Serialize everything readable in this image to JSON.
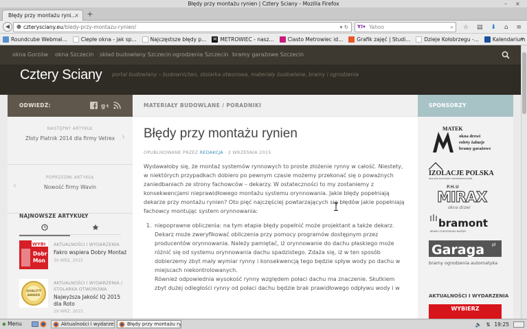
{
  "window": {
    "title": "Błędy przy montażu rynien | Cztery Sciany - Mozilla Firefox",
    "controls": [
      "–",
      "×"
    ]
  },
  "tabs": [
    {
      "label": "Błędy przy montażu ryni...",
      "close": "×"
    }
  ],
  "new_tab": "+",
  "address": {
    "host": "czterysciany.eu",
    "path": "/bledy-przy-montazu-rynien/",
    "icons": "▾ ↻"
  },
  "search": {
    "engine": "Y!▾",
    "placeholder": "Yahoo",
    "go": "🔍"
  },
  "bookmarks": [
    {
      "label": "Roundcube Webmai...",
      "icon_color": "#5a8fd0",
      "icon": ""
    },
    {
      "label": "Ciepłe okna - jak sp...",
      "icon_color": "#cfcfcf",
      "icon": ""
    },
    {
      "label": "Najczęstsze błędy p...",
      "icon_color": "#cfcfcf",
      "icon": ""
    },
    {
      "label": "METROWIEC - nasz...",
      "icon_color": "#111111",
      "icon": "M"
    },
    {
      "label": "Ciasto Metrowiec id...",
      "icon_color": "#c81c7b",
      "icon": ""
    },
    {
      "label": "Grafik zajęć | Studi...",
      "icon_color": "#e6582a",
      "icon": ""
    },
    {
      "label": "Dzieje Kołobrzegu -...",
      "icon_color": "#cfcfcf",
      "icon": ""
    },
    {
      "label": "Kalendarium Histor...",
      "icon_color": "#1b4fa0",
      "icon": ""
    }
  ],
  "bookmarks_more": "»",
  "site": {
    "nav": [
      "okna Gorzów",
      "okna Szczecin",
      "skład budowlany Szczecin",
      "ogrodzenia Szczecin",
      "bramy garażowe Szczecin"
    ],
    "title": "Cztery Sciany",
    "tagline": "portal budowlany – budownictwo, stolarka otworowa, materiały budowlane, bramy i ogrodzenia"
  },
  "left": {
    "follow_label": "ODWIEDŹ:",
    "next": {
      "kicker": "NASTĘPNY ARTYKUŁ",
      "title": "Złoty Platnik 2014 dla firmy Vetrex",
      "arrow": "›"
    },
    "prev": {
      "kicker": "POPRZEDNI ARTYKUŁ",
      "title": "Nowość firmy Wavin",
      "arrow": "‹"
    },
    "newest_title": "NAJNOWSZE ARTYKUŁY",
    "posts": [
      {
        "category": "AKTUALNOŚCI I WYDARZENIA",
        "title": "Fakro wspiera Dobry Montaż",
        "date": "30 WRZ, 2015",
        "thumb_text": "WYBIE\nDobr\nMon"
      },
      {
        "category": "AKTUALNOŚCI I WYDARZENIA / STOLARKA OTWOROWA",
        "title": "Najwyższa Jakość IQ 2015 dla Roto",
        "date": "29 WRZ, 2015",
        "thumb_text": "QUALITY\nAWARD"
      }
    ]
  },
  "main": {
    "breadcrumb": "MATERIAŁY BUDOWLANE / PORADNIKI",
    "title": "Błędy przy montażu rynien",
    "meta_prefix": "OPUBLIKOWANE PRZEZ",
    "meta_author": "REDAKCJA",
    "meta_date": "· 2 WRZEŚNIA 2015",
    "intro": "Wydawałoby się, że montaż systemów rynnowych to proste złożenie rynny w całość. Niestety, w niektórych przypadkach dobiero po pewnym czasie możemy przekonać się o poważnych zaniedbaniach ze strony fachowców – dekarzy. W ostateczności to my zostaniemy z konsekwencjami nieprawidłowego montażu systemu orynnowania. Jakie błędy popełniają dekarze przy montażu rynien? Oto pięć najczęściej powtarzających się błędów jakie popełniają fachowcy montując system orynnowania:",
    "list": [
      {
        "lines": [
          "niepoprawne obliczenia: na tym etapie błędy popełnić może projektant a także dekarz. Dekarz może zweryfikować obliczenia przy pomocy programów dostępnym przez producentów orynnowania. Należy pamiętać, iż orynnowanie do dachu płaskiego może różnić się od systemu orynnowania dachu spadzistego. Zdaża się, iż w ten sposób dobierzemy zbyt mały wymiar rynny i konsekwencją tego będzie spływ wody po dachu w miejscach niekontrolowanych.",
          "Również odpowiednia wysokość rynny względem połaci dachu ma znaczenie. Skutkiem zbyt dużej odległości rynny od połaci dachu będzie brak prawidłowego odpływu wody i w"
        ]
      }
    ]
  },
  "right": {
    "sponsors_label": "SPONSORZY",
    "logos": {
      "matek": {
        "name": "MATEK",
        "lines": [
          "okna drzwi",
          "rolety żaluzje",
          "bramy garażowe"
        ]
      },
      "izolacje": {
        "name": "IZOLACJE POLSKA",
        "sub": "IZOLACJE DACHOWE I WIATROIZOLACYJNE"
      },
      "mirax": {
        "prefix": "P.H.U",
        "name": "MIRAX",
        "sub": "okna drzwi"
      },
      "bramont": {
        "name": "bramont",
        "sub": "BRAMY OGRODZENIA NAPĘDY"
      },
      "garaga": {
        "name": "Garaga",
        "suffix": "pl",
        "sub": "bramy ogrodzenia automatyka"
      }
    },
    "news_category": "AKTUALNOŚCI I WYDARZENIA",
    "news_banner": "WYBIERZ"
  },
  "taskbar": {
    "start": "Menu",
    "tasks": [
      {
        "label": "Aktualności i wydarzenia |...",
        "active": false
      },
      {
        "label": "Błędy przy montażu rynie...",
        "active": true
      }
    ],
    "clock": "19:25"
  },
  "colors": {
    "nav_bg": "#3d3830",
    "header_bg": "#2f2b25",
    "follow_bg": "#5f574b",
    "sponsors_bg": "#a7c3c6",
    "accent_link": "#3b8dbd"
  }
}
